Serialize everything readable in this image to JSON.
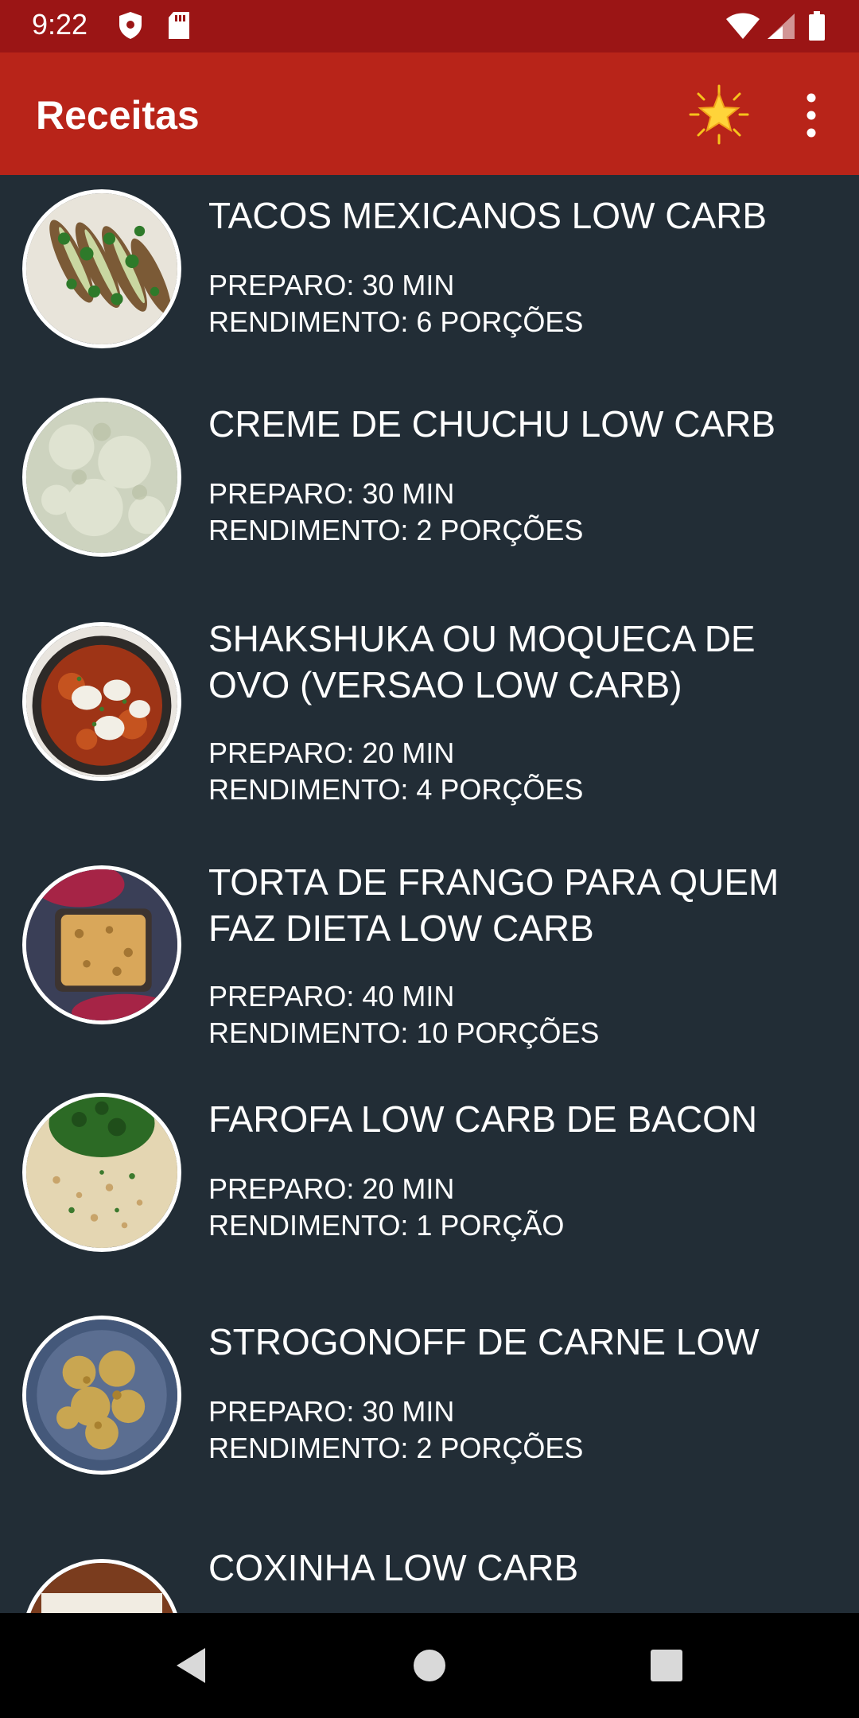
{
  "status_bar": {
    "time": "9:22",
    "icons": [
      "shield-icon",
      "sd-card-icon",
      "wifi-icon",
      "signal-icon",
      "battery-icon"
    ]
  },
  "app_bar": {
    "title": "Receitas",
    "actions": [
      "star-icon",
      "more-vert-icon"
    ]
  },
  "recipes": [
    {
      "title": "TACOS MEXICANOS LOW CARB",
      "preparo": "PREPARO: 30 MIN",
      "rendimento": "RENDIMENTO: 6 PORÇÕES"
    },
    {
      "title": "CREME DE CHUCHU LOW CARB",
      "preparo": "PREPARO: 30 MIN",
      "rendimento": "RENDIMENTO: 2 PORÇÕES"
    },
    {
      "title": "SHAKSHUKA OU MOQUECA DE OVO (VERSAO LOW CARB)",
      "preparo": "PREPARO: 20 MIN",
      "rendimento": "RENDIMENTO: 4 PORÇÕES"
    },
    {
      "title": "TORTA DE FRANGO PARA QUEM FAZ DIETA LOW CARB",
      "preparo": "PREPARO: 40 MIN",
      "rendimento": "RENDIMENTO: 10 PORÇÕES"
    },
    {
      "title": "FAROFA LOW CARB DE BACON",
      "preparo": "PREPARO: 20 MIN",
      "rendimento": "RENDIMENTO: 1 PORÇÃO"
    },
    {
      "title": "STROGONOFF DE CARNE LOW",
      "preparo": "PREPARO: 30 MIN",
      "rendimento": "RENDIMENTO: 2 PORÇÕES"
    },
    {
      "title": "COXINHA LOW CARB",
      "preparo": "",
      "rendimento": ""
    }
  ],
  "nav_bar": {
    "buttons": [
      "back-icon",
      "home-icon",
      "recents-icon"
    ]
  },
  "colors": {
    "status_bar": "#9b1515",
    "app_bar": "#b82419",
    "background": "#222d36",
    "text": "#ffffff"
  }
}
